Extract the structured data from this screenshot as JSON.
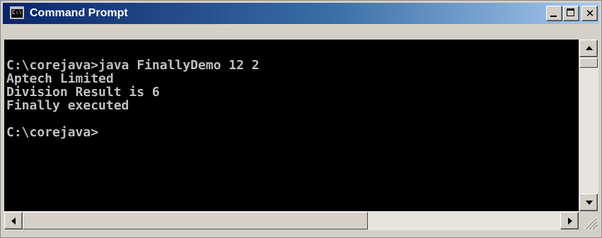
{
  "window": {
    "title": "Command Prompt",
    "icon": "console-app-icon",
    "icon_text": "C:\\",
    "titlebar_color": "#0a246a"
  },
  "controls": {
    "minimize": "minimize-icon",
    "maximize": "maximize-icon",
    "close": "close-icon",
    "close_glyph": "✕"
  },
  "console": {
    "background": "#000000",
    "text_color": "#c0c0c0",
    "lines": [
      "C:\\corejava>java FinallyDemo 12 2",
      "Aptech Limited",
      "Division Result is 6",
      "Finally executed",
      "",
      "C:\\corejava>"
    ]
  },
  "scrollbars": {
    "up_icon": "scroll-up-arrow-icon",
    "down_icon": "scroll-down-arrow-icon",
    "left_icon": "scroll-left-arrow-icon",
    "right_icon": "scroll-right-arrow-icon",
    "resize_icon": "resize-grip-icon"
  }
}
